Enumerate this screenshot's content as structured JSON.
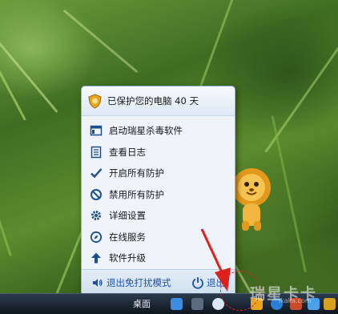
{
  "menu": {
    "header": "已保护您的电脑 40 天",
    "items": [
      {
        "label": "启动瑞星杀毒软件",
        "icon": "window-icon"
      },
      {
        "label": "查看日志",
        "icon": "log-icon"
      },
      {
        "label": "开启所有防护",
        "icon": "check-icon"
      },
      {
        "label": "禁用所有防护",
        "icon": "forbid-icon"
      },
      {
        "label": "详细设置",
        "icon": "gear-icon"
      },
      {
        "label": "在线服务",
        "icon": "compass-icon"
      },
      {
        "label": "软件升级",
        "icon": "up-arrow-icon"
      }
    ],
    "footer": {
      "silent_mode": "退出免打扰模式",
      "quit": "退出"
    }
  },
  "taskbar": {
    "desktop_label": "桌面"
  },
  "watermark": {
    "text": "瑞星卡卡",
    "sub": "ikaka.com"
  },
  "colors": {
    "menu_bg": "#eef4fa",
    "footer_text": "#1c4fa8",
    "annotation_red": "#e0201c"
  }
}
